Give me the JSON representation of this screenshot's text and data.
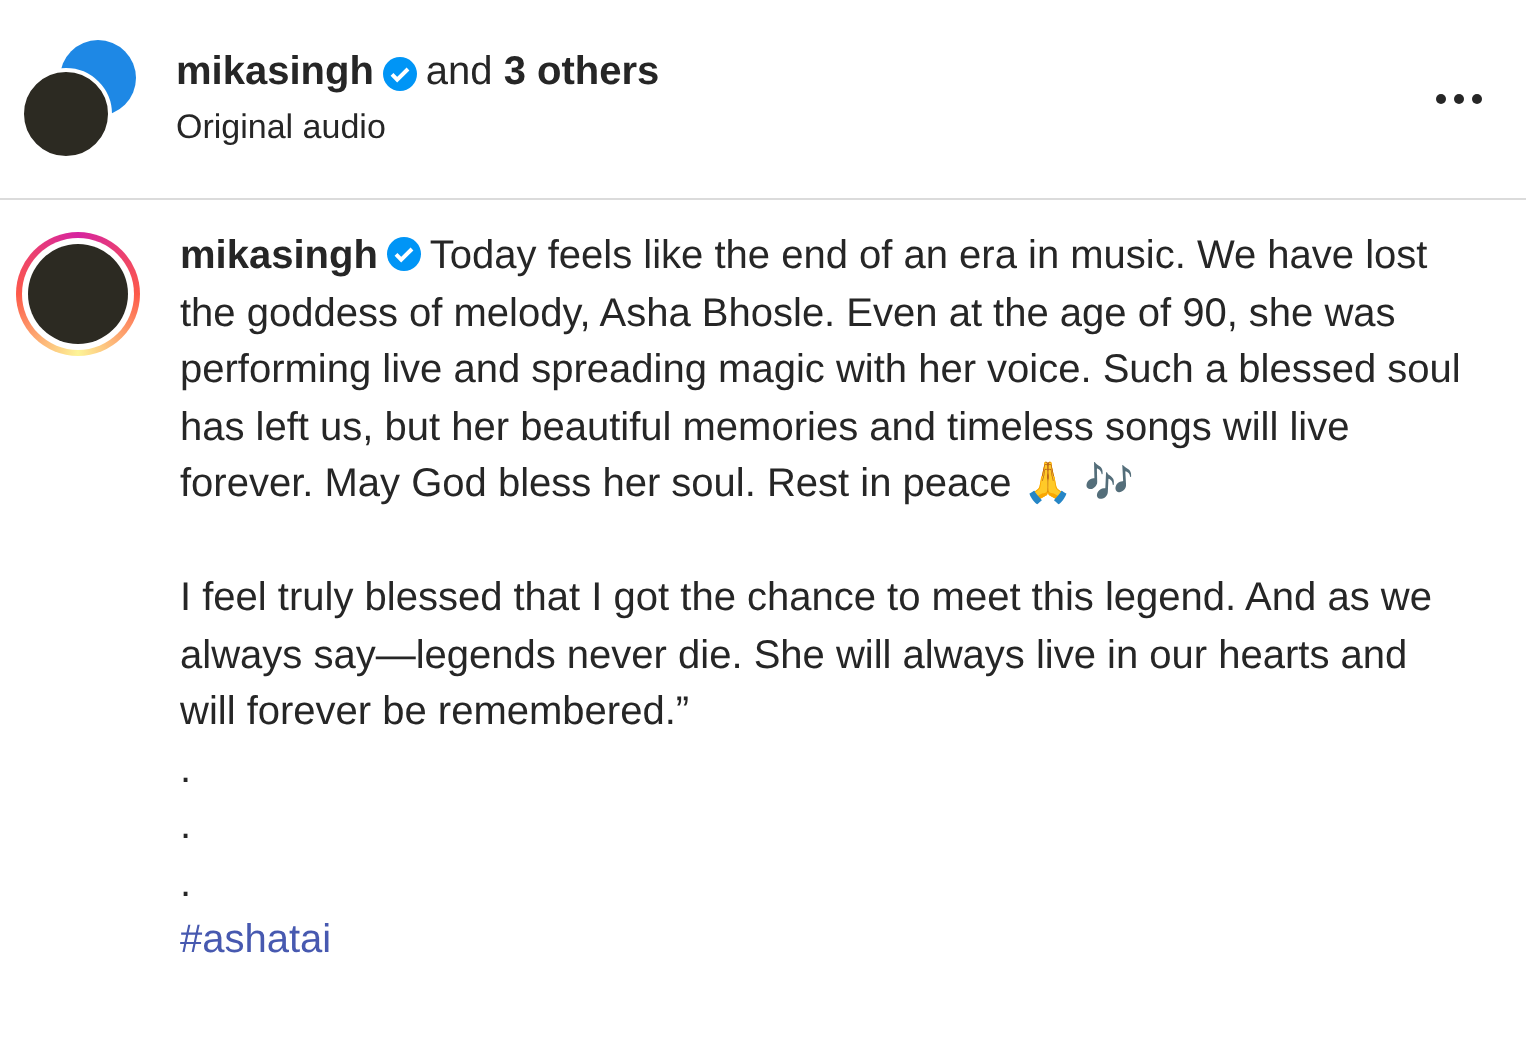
{
  "header": {
    "username": "mikasingh",
    "verified": true,
    "collaborators": "and **3 others**",
    "audio": "Original audio"
  },
  "caption": {
    "username": "mikasingh",
    "verified": true,
    "has_story_ring": true,
    "text": "Today feels like the end of an era in music. We have lost the goddess of melody, Asha Bhosle. Even at the age of 90, she was performing live and spreading magic with her voice. Such a blessed soul has left us, but her beautiful memories and timeless songs will live forever. May God bless her soul. Rest in peace 🙏 🎶",
    "paragraphs": [
      "I feel truly blessed that I got the chance to meet this legend. And as we always say—legends never die. She will always live in our hearts and will forever be remembered.”"
    ],
    "dots": [
      ".",
      ".",
      "."
    ],
    "hashtag": "#ashatai"
  }
}
